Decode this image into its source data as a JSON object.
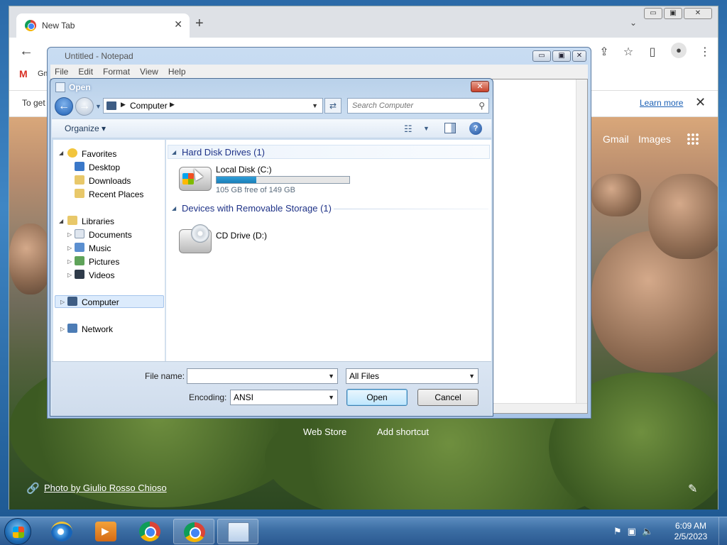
{
  "browser": {
    "tab_title": "New Tab",
    "tab_close": "✕",
    "new_tab": "+",
    "tab_search": "⌄",
    "window_controls": [
      "▭",
      "▣",
      "✕"
    ],
    "back": "←",
    "bookmark_gmail": "Gm",
    "infobar_text": "To get",
    "infobar_link": "Learn more",
    "infobar_close": "✕",
    "toolbar_icons": [
      "share-icon",
      "star-icon",
      "sidepanel-icon",
      "profile-icon",
      "menu-icon"
    ]
  },
  "ntp": {
    "gmail": "Gmail",
    "images": "Images",
    "web_store": "Web Store",
    "add_shortcut": "Add shortcut",
    "photo_credit": "Photo by Giulio Rosso Chioso",
    "link_icon": "🔗",
    "edit_icon": "✎"
  },
  "notepad": {
    "title": "Untitled - Notepad",
    "menu": [
      "File",
      "Edit",
      "Format",
      "View",
      "Help"
    ],
    "controls": [
      "▭",
      "▣",
      "✕"
    ]
  },
  "dialog": {
    "title": "Open",
    "close": "✕",
    "address": {
      "location": "Computer",
      "separator": "▶"
    },
    "search_placeholder": "Search Computer",
    "organize": "Organize",
    "nav": {
      "favorites": "Favorites",
      "desktop": "Desktop",
      "downloads": "Downloads",
      "recent_places": "Recent Places",
      "libraries": "Libraries",
      "documents": "Documents",
      "music": "Music",
      "pictures": "Pictures",
      "videos": "Videos",
      "computer": "Computer",
      "network": "Network"
    },
    "groups": {
      "hard_disk": "Hard Disk Drives (1)",
      "removable": "Devices with Removable Storage (1)"
    },
    "drives": {
      "local_name": "Local Disk (C:)",
      "local_free": "105 GB free of 149 GB",
      "local_used_fraction": 0.3,
      "cd_name": "CD Drive (D:)"
    },
    "file_name_label": "File name:",
    "file_name_value": "",
    "file_type": "All Files",
    "encoding_label": "Encoding:",
    "encoding_value": "ANSI",
    "open_button": "Open",
    "cancel_button": "Cancel"
  },
  "taskbar": {
    "time": "6:09 AM",
    "date": "2/5/2023",
    "tray_icons": [
      "flag-icon",
      "network-icon",
      "volume-icon"
    ]
  }
}
